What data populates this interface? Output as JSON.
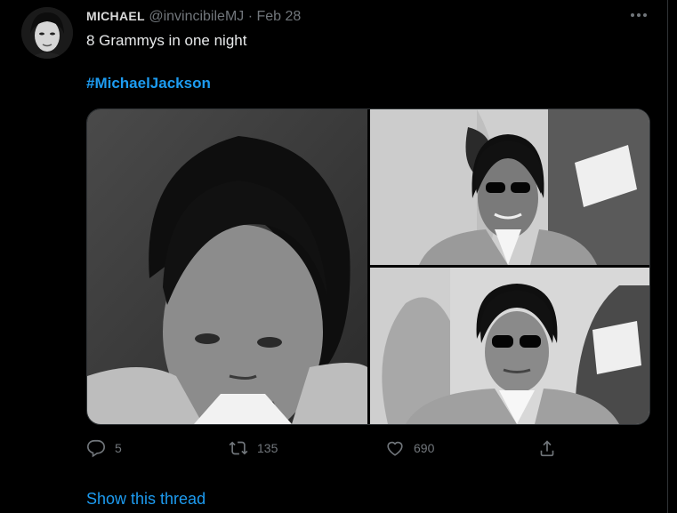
{
  "tweet": {
    "author_name": "MICHAEL",
    "handle": "@invincibileMJ",
    "separator": "·",
    "date": "Feb 28",
    "more_icon": "more-horizontal-icon",
    "text": "8 Grammys in one night",
    "hashtag": "#MichaelJackson",
    "media": [
      {
        "name": "photo-1",
        "description_icon": "image"
      },
      {
        "name": "photo-2",
        "description_icon": "image"
      },
      {
        "name": "photo-3",
        "description_icon": "image"
      }
    ]
  },
  "actions": {
    "reply_icon": "reply-icon",
    "reply_count": "5",
    "retweet_icon": "retweet-icon",
    "retweet_count": "135",
    "like_icon": "heart-icon",
    "like_count": "690",
    "share_icon": "share-icon"
  },
  "thread_link": "Show this thread",
  "colors": {
    "background": "#000000",
    "link": "#1d9bf0",
    "muted": "#71767b",
    "text": "#e7e9ea"
  }
}
